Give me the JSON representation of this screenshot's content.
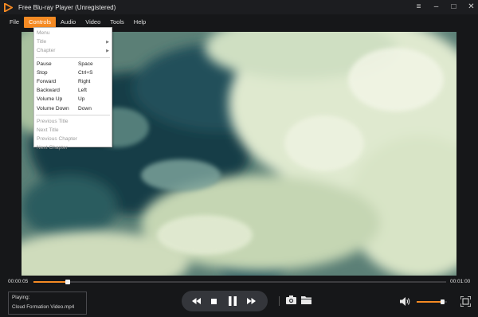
{
  "app": {
    "title": "Free Blu-ray Player (Unregistered)",
    "accent": "#f58a23"
  },
  "window_controls": {
    "menu": "≡",
    "minimize": "–",
    "maximize": "□",
    "close": "✕"
  },
  "menubar": {
    "items": [
      "File",
      "Controls",
      "Audio",
      "Video",
      "Tools",
      "Help"
    ],
    "active": "Controls"
  },
  "controls_menu": {
    "group1": [
      {
        "label": "Menu",
        "disabled": true
      },
      {
        "label": "Title",
        "disabled": true,
        "submenu": true
      },
      {
        "label": "Chapter",
        "disabled": true,
        "submenu": true
      }
    ],
    "group2": [
      {
        "label": "Pause",
        "shortcut": "Space"
      },
      {
        "label": "Stop",
        "shortcut": "Ctrl+S"
      },
      {
        "label": "Forward",
        "shortcut": "Right"
      },
      {
        "label": "Backward",
        "shortcut": "Left"
      },
      {
        "label": "Volume Up",
        "shortcut": "Up"
      },
      {
        "label": "Volume Down",
        "shortcut": "Down"
      }
    ],
    "group3": [
      {
        "label": "Previous Title",
        "disabled": true
      },
      {
        "label": "Next Title",
        "disabled": true
      },
      {
        "label": "Previous Chapter",
        "disabled": true
      },
      {
        "label": "Next Chapter",
        "disabled": true
      }
    ]
  },
  "playback": {
    "current_time": "00:00:05",
    "total_time": "00:01:00",
    "progress_fraction": 0.083,
    "volume_fraction": 0.85
  },
  "now_playing": {
    "label": "Playing:",
    "file": "Cloud Formation Video.mp4"
  },
  "icons": {
    "logo": "play-triangle-icon",
    "rewind": "rewind-icon",
    "stop": "stop-icon",
    "pause": "pause-icon",
    "forward": "fast-forward-icon",
    "snapshot": "camera-icon",
    "folder": "folder-icon",
    "volume": "speaker-icon",
    "fullscreen": "fullscreen-icon"
  }
}
